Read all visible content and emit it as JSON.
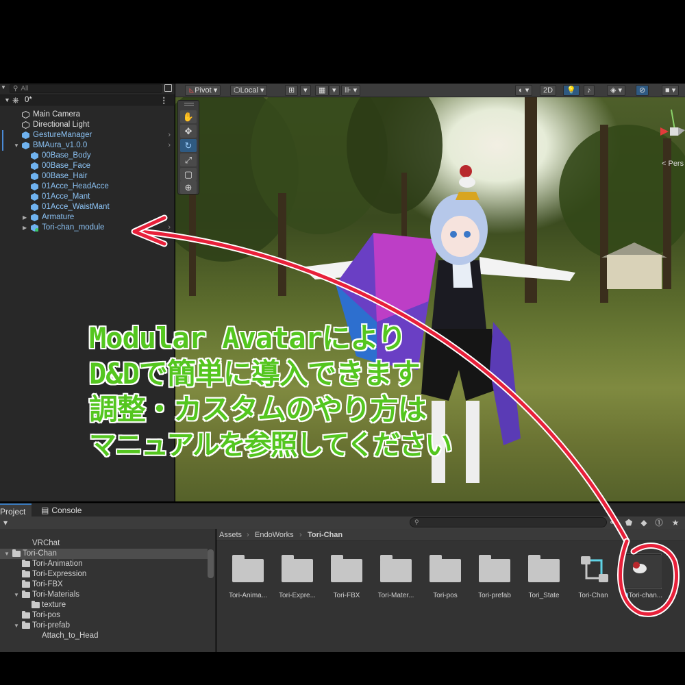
{
  "hierarchy": {
    "search_placeholder": "All",
    "scene_name": "0*",
    "items": [
      {
        "label": "Main Camera",
        "depth": 1,
        "style": "white"
      },
      {
        "label": "Directional Light",
        "depth": 1,
        "style": "white"
      },
      {
        "label": "GestureManager",
        "depth": 1,
        "style": "blue"
      },
      {
        "label": "BMAura_v1.0.0",
        "depth": 1,
        "style": "blue"
      },
      {
        "label": "00Base_Body",
        "depth": 2,
        "style": "blue"
      },
      {
        "label": "00Base_Face",
        "depth": 2,
        "style": "blue"
      },
      {
        "label": "00Base_Hair",
        "depth": 2,
        "style": "blue"
      },
      {
        "label": "01Acce_HeadAcce",
        "depth": 2,
        "style": "blue"
      },
      {
        "label": "01Acce_Mant",
        "depth": 2,
        "style": "blue"
      },
      {
        "label": "01Acce_WaistMant",
        "depth": 2,
        "style": "blue"
      },
      {
        "label": "Armature",
        "depth": 2,
        "style": "blue"
      },
      {
        "label": "Tori-chan_module",
        "depth": 2,
        "style": "blue"
      }
    ]
  },
  "scene_toolbar": {
    "pivot_label": "Pivot",
    "local_label": "Local",
    "mode_2d_label": "2D"
  },
  "scene": {
    "persp_label": "< Pers"
  },
  "caption": {
    "line1": "Modular Avatarにより",
    "line2": "D&Dで簡単に導入できます",
    "line3": "調整・カスタムのやり方は",
    "line4": "マニュアルを参照してください"
  },
  "project_panel": {
    "tabs": [
      {
        "label": "Project",
        "active": true
      },
      {
        "label": "Console",
        "active": false
      }
    ],
    "breadcrumb": [
      "Assets",
      "EndoWorks",
      "Tori-Chan"
    ],
    "tree": [
      {
        "label": "VRChat",
        "depth": 2,
        "folder": false
      },
      {
        "label": "Tori-Chan",
        "depth": 1,
        "folder": true,
        "selected": true,
        "expanded": true
      },
      {
        "label": "Tori-Animation",
        "depth": 2,
        "folder": true
      },
      {
        "label": "Tori-Expression",
        "depth": 2,
        "folder": true
      },
      {
        "label": "Tori-FBX",
        "depth": 2,
        "folder": true
      },
      {
        "label": "Tori-Materials",
        "depth": 2,
        "folder": true,
        "expanded": true
      },
      {
        "label": "texture",
        "depth": 3,
        "folder": true
      },
      {
        "label": "Tori-pos",
        "depth": 2,
        "folder": true
      },
      {
        "label": "Tori-prefab",
        "depth": 2,
        "folder": true,
        "expanded": true
      },
      {
        "label": "Attach_to_Head",
        "depth": 3,
        "folder": false
      }
    ],
    "assets": [
      {
        "label": "Tori-Anima...",
        "kind": "folder"
      },
      {
        "label": "Tori-Expre...",
        "kind": "folder"
      },
      {
        "label": "Tori-FBX",
        "kind": "folder"
      },
      {
        "label": "Tori-Mater...",
        "kind": "folder"
      },
      {
        "label": "Tori-pos",
        "kind": "folder"
      },
      {
        "label": "Tori-prefab",
        "kind": "folder"
      },
      {
        "label": "Tori_State",
        "kind": "folder"
      },
      {
        "label": "Tori-Chan",
        "kind": "animator"
      },
      {
        "label": "Tori-chan...",
        "kind": "prefab"
      }
    ]
  },
  "colors": {
    "caption_green": "#54c61f",
    "arrow_red": "#e8203a",
    "prefab_blue": "#8cc3f5",
    "selection_blue": "#2f5a82"
  }
}
